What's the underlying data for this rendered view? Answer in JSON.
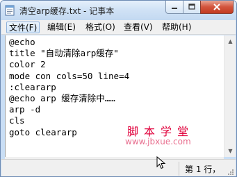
{
  "window": {
    "title": "清空arp缓存.txt - 记事本",
    "app_icon": "notepad-icon",
    "buttons": {
      "minimize_icon": "minimize-icon",
      "maximize_icon": "maximize-icon",
      "close_icon": "close-icon"
    }
  },
  "menu": {
    "items": [
      {
        "label": "文件(F)"
      },
      {
        "label": "编辑(E)"
      },
      {
        "label": "格式(O)"
      },
      {
        "label": "查看(V)"
      },
      {
        "label": "帮助(H)"
      }
    ],
    "active_index": 0
  },
  "editor": {
    "content": "@echo\ntitle \"自动清除arp缓存\"\ncolor 2\nmode con cols=50 line=4\n:cleararp\n@echo arp 缓存清除中……\narp -d\ncls\ngoto cleararp"
  },
  "watermark": {
    "name": "脚本学堂",
    "url": "www.jbxue.com"
  },
  "statusbar": {
    "position": "第 1 行，"
  },
  "colors": {
    "title_bar": "#cfe1f5",
    "close_button": "#c23b22",
    "watermark": "#e0003b"
  }
}
